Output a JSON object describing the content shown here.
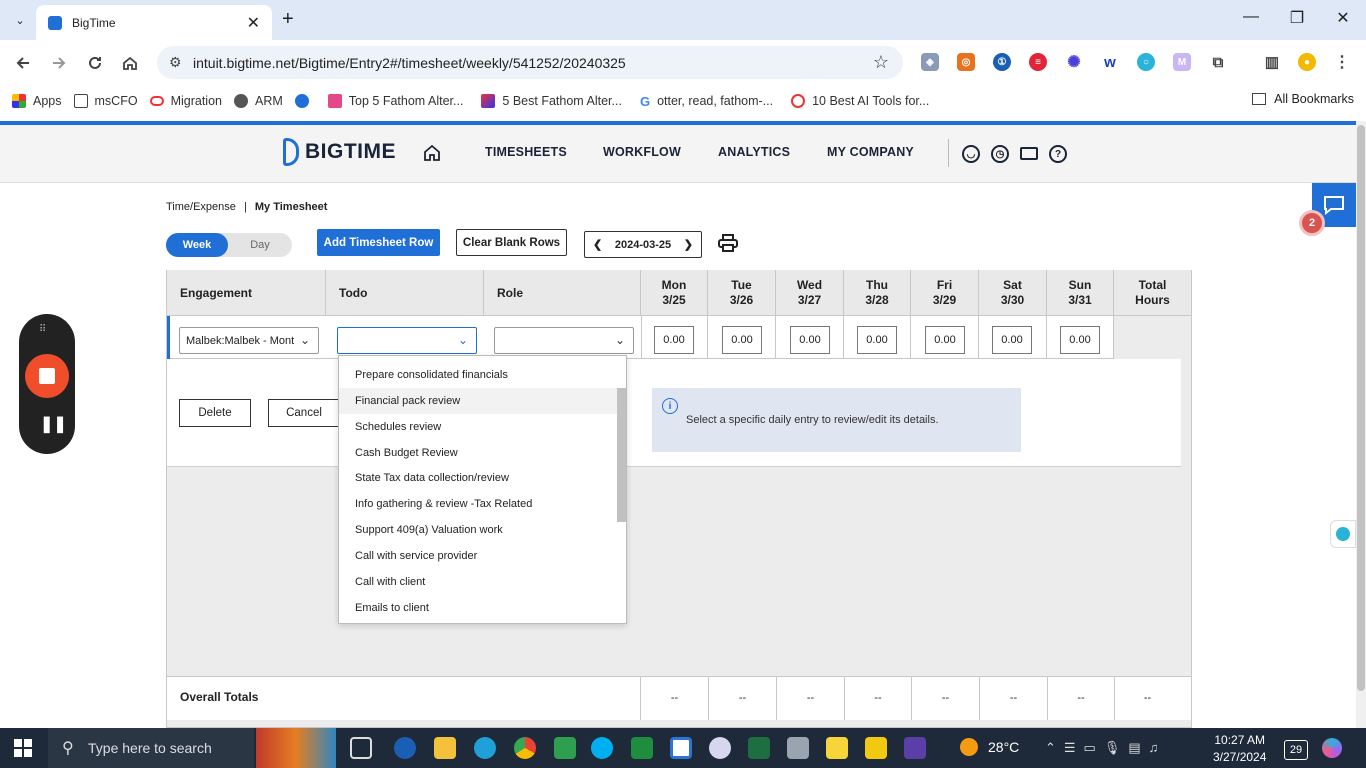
{
  "browser": {
    "tab_title": "BigTime",
    "url": "intuit.bigtime.net/Bigtime/Entry2#/timesheet/weekly/541252/20240325",
    "bookmarks": [
      "Apps",
      "msCFO",
      "Migration",
      "ARM",
      "",
      "Top 5 Fathom Alter...",
      "5 Best Fathom Alter...",
      "otter, read, fathom-...",
      "10 Best AI Tools for..."
    ],
    "all_bookmarks": "All Bookmarks"
  },
  "app": {
    "brand": "BIGTIME",
    "nav": [
      "TIMESHEETS",
      "WORKFLOW",
      "ANALYTICS",
      "MY COMPANY"
    ],
    "chat_badge": "2",
    "breadcrumb": {
      "section": "Time/Expense",
      "separator": "|",
      "page": "My Timesheet"
    },
    "view_toggle": {
      "week": "Week",
      "day": "Day",
      "selected": "Week"
    },
    "add_row_label": "Add Timesheet Row",
    "clear_rows_label": "Clear Blank Rows",
    "date": "2024-03-25",
    "columns": {
      "engagement": "Engagement",
      "todo": "Todo",
      "role": "Role",
      "total_line1": "Total",
      "total_line2": "Hours"
    },
    "days": [
      {
        "name": "Mon",
        "date": "3/25"
      },
      {
        "name": "Tue",
        "date": "3/26"
      },
      {
        "name": "Wed",
        "date": "3/27"
      },
      {
        "name": "Thu",
        "date": "3/28"
      },
      {
        "name": "Fri",
        "date": "3/29"
      },
      {
        "name": "Sat",
        "date": "3/30"
      },
      {
        "name": "Sun",
        "date": "3/31"
      }
    ],
    "row": {
      "engagement": "Malbek:Malbek - Mont",
      "todo": "",
      "role": "",
      "hours": [
        "0.00",
        "0.00",
        "0.00",
        "0.00",
        "0.00",
        "0.00",
        "0.00"
      ]
    },
    "delete_label": "Delete",
    "cancel_label": "Cancel",
    "info_text": "Select a specific daily entry to review/edit its details.",
    "todo_options": [
      "Prepare consolidated financials",
      "Financial pack review",
      "Schedules review",
      "Cash Budget Review",
      "State Tax data collection/review",
      "Info gathering & review -Tax Related",
      "Support 409(a) Valuation work",
      "Call with service provider",
      "Call with client",
      "Emails to client"
    ],
    "hovered_option": "Financial pack review",
    "totals_label": "Overall Totals",
    "totals": [
      "--",
      "--",
      "--",
      "--",
      "--",
      "--",
      "--",
      "--"
    ]
  },
  "taskbar": {
    "search_placeholder": "Type here to search",
    "weather": "28°C",
    "time": "10:27 AM",
    "date": "3/27/2024",
    "notifications": "29"
  },
  "colors": {
    "brand_blue": "#1f6fd6",
    "badge_red": "#d9534f",
    "record_orange": "#f04e2a"
  }
}
